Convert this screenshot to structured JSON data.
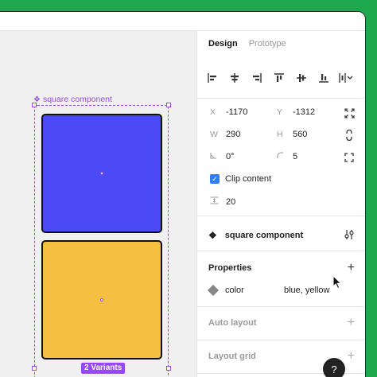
{
  "canvas": {
    "component_label": "square component",
    "variants_badge": "2 Variants"
  },
  "tabs": [
    {
      "label": "Design"
    },
    {
      "label": "Prototype"
    }
  ],
  "props": {
    "x_label": "X",
    "x_value": "-1170",
    "y_label": "Y",
    "y_value": "-1312",
    "w_label": "W",
    "w_value": "290",
    "h_label": "H",
    "h_value": "560",
    "rotation_value": "0°",
    "radius_value": "5",
    "clip_label": "Clip content",
    "spacing_value": "20"
  },
  "component": {
    "name": "square component"
  },
  "properties": {
    "title": "Properties",
    "row_label": "color",
    "row_value": "blue, yellow"
  },
  "sections": {
    "auto_layout": "Auto layout",
    "layout_grid": "Layout grid"
  },
  "help": "?",
  "colors": {
    "accent": "#9747ff",
    "blue_square": "#4b4bf5",
    "yellow_square": "#f5bf42",
    "checkbox": "#2d7ff9"
  }
}
